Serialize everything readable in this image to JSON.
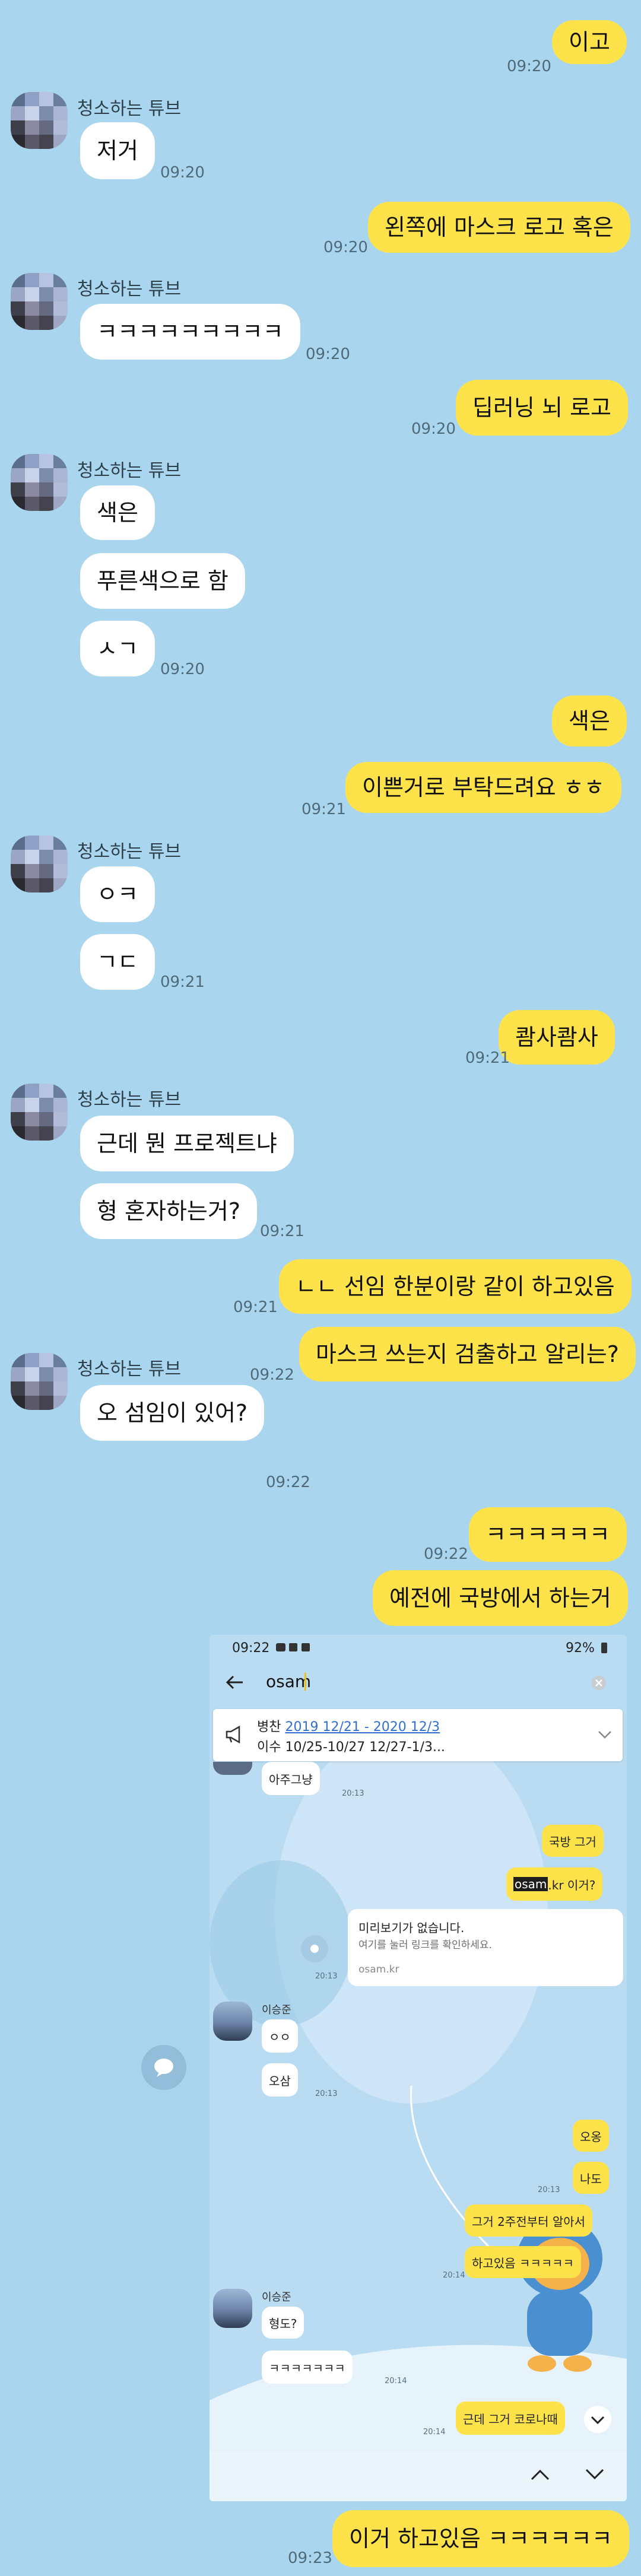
{
  "partner_name": "청소하는 튜브",
  "messages": {
    "m1": {
      "text": "이고",
      "time": "09:20"
    },
    "m2": {
      "text": "저거",
      "time": "09:20"
    },
    "m3": {
      "text": "왼쪽에 마스크 로고 혹은",
      "time": "09:20"
    },
    "m4": {
      "text": "ㅋㅋㅋㅋㅋㅋㅋㅋㅋ",
      "time": "09:20"
    },
    "m5": {
      "text": "딥러닝 뇌 로고",
      "time": "09:20"
    },
    "m6": {
      "text": "색은"
    },
    "m7": {
      "text": "푸른색으로 함"
    },
    "m8": {
      "text": "ㅅㄱ",
      "time": "09:20"
    },
    "m9": {
      "text": "색은"
    },
    "m10": {
      "text": "이쁜거로 부탁드려요 ㅎㅎ",
      "time": "09:21"
    },
    "m11": {
      "text": "ㅇㅋ"
    },
    "m12": {
      "text": "ㄱㄷ",
      "time": "09:21"
    },
    "m13": {
      "text": "쾀사쾀사",
      "time": "09:21"
    },
    "m14": {
      "text": "근데 뭔 프로젝트냐"
    },
    "m15": {
      "text": "형 혼자하는거?",
      "time": "09:21"
    },
    "m16": {
      "text": "ㄴㄴ 선임 한분이랑 같이 하고있음",
      "time": "09:21"
    },
    "m17": {
      "text": "마스크 쓰는지 검출하고 알리는?",
      "time": "09:22"
    },
    "m18": {
      "text": "오 섬임이 있어?",
      "time": "09:22"
    },
    "m19": {
      "text": "ㅋㅋㅋㅋㅋㅋ",
      "time": "09:22"
    },
    "m20": {
      "text": "예전에 국방에서 하는거"
    },
    "m21": {
      "text": "이거 하고있음 ㅋㅋㅋㅋㅋㅋ",
      "time": "09:23"
    }
  },
  "shared_screenshot": {
    "status_time": "09:22",
    "battery": "92%",
    "search_query": "osam",
    "notice_line1_prefix": "병찬 ",
    "notice_line1_link": "2019 12/21 - 2020 12/3",
    "notice_line2": "이수 10/25-10/27 12/27-1/3...",
    "msgs": {
      "a1": {
        "text": "아주그냥",
        "time": "20:13"
      },
      "a2": {
        "text": "국방 그거"
      },
      "a3_highlight": "osam",
      "a3_rest": ".kr 이거?",
      "link_title": "미리보기가 없습니다.",
      "link_desc": "여기를 눌러 링크를 확인하세요.",
      "link_url": "osam.kr",
      "link_time": "20:13",
      "sender": "이승준",
      "a4": {
        "text": "ㅇㅇ"
      },
      "a5": {
        "text": "오삼",
        "time": "20:13"
      },
      "a6": {
        "text": "오옹"
      },
      "a7": {
        "text": "나도",
        "time": "20:13"
      },
      "a8": {
        "text": "그거 2주전부터 알아서"
      },
      "a9": {
        "text": "하고있음 ㅋㅋㅋㅋㅋ",
        "time": "20:14"
      },
      "a10": {
        "text": "형도?"
      },
      "a11": {
        "text": "ㅋㅋㅋㅋㅋㅋㅋ",
        "time": "20:14"
      },
      "a12": {
        "text": "근데 그거 코로나때",
        "time": "20:14"
      }
    }
  },
  "colors": {
    "background": "#a9d6ee",
    "my_bubble": "#fde24a",
    "their_bubble": "#ffffff",
    "link": "#2f6fd1"
  },
  "icons": {
    "back": "arrow-left-icon",
    "clear": "close-circle-icon",
    "notice": "megaphone-icon",
    "expand": "chevron-down-icon",
    "share": "share-icon",
    "up": "chevron-up-icon",
    "down": "chevron-down-icon",
    "chat": "chat-bubble-icon"
  }
}
